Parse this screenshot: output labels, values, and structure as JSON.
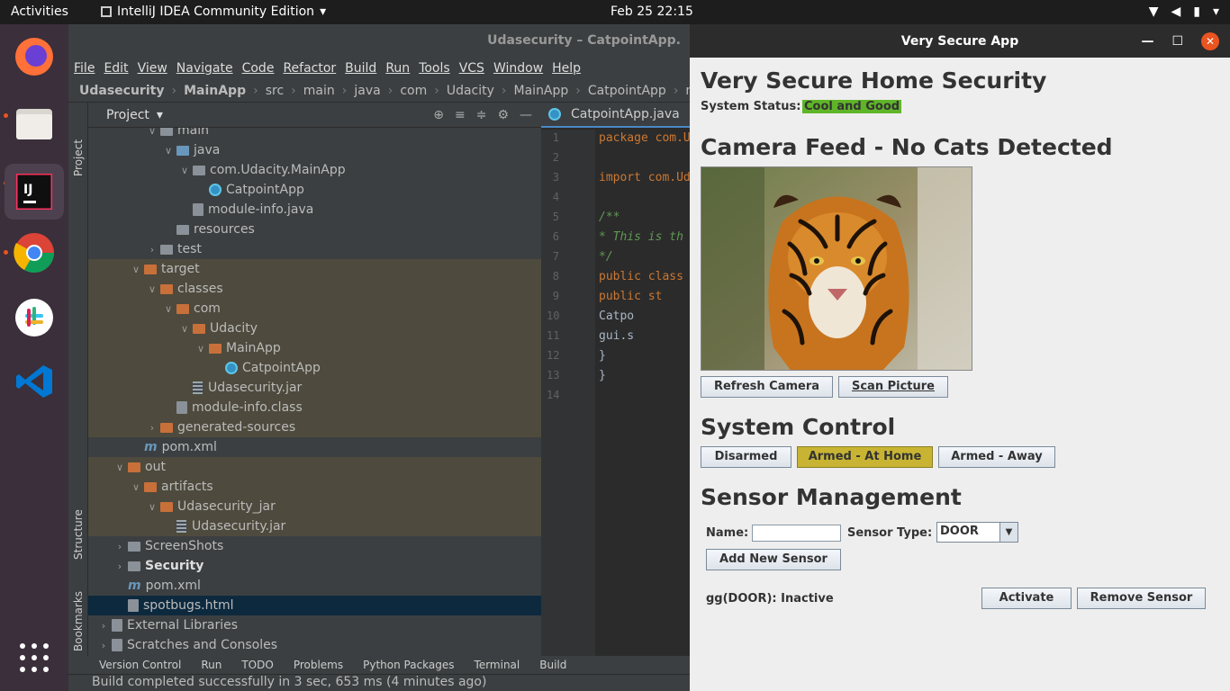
{
  "topbar": {
    "activities": "Activities",
    "app_menu": "IntelliJ IDEA Community Edition",
    "clock": "Feb 25  22:15"
  },
  "ide": {
    "window_title": "Udasecurity – CatpointApp.",
    "menu": [
      "File",
      "Edit",
      "View",
      "Navigate",
      "Code",
      "Refactor",
      "Build",
      "Run",
      "Tools",
      "VCS",
      "Window",
      "Help"
    ],
    "breadcrumbs": [
      "Udasecurity",
      "MainApp",
      "src",
      "main",
      "java",
      "com",
      "Udacity",
      "MainApp",
      "CatpointApp",
      "main"
    ],
    "side_tabs": {
      "project": "Project",
      "structure": "Structure",
      "bookmarks": "Bookmarks"
    },
    "project_label": "Project",
    "tree": [
      {
        "label": "main",
        "indent": 4,
        "icon": "folder-gray",
        "arrow": "down"
      },
      {
        "label": "java",
        "indent": 5,
        "icon": "folder-blue",
        "arrow": "down"
      },
      {
        "label": "com.Udacity.MainApp",
        "indent": 6,
        "icon": "package",
        "arrow": "down"
      },
      {
        "label": "CatpointApp",
        "indent": 7,
        "icon": "class"
      },
      {
        "label": "module-info.java",
        "indent": 6,
        "icon": "java"
      },
      {
        "label": "resources",
        "indent": 5,
        "icon": "folder-gray"
      },
      {
        "label": "test",
        "indent": 4,
        "icon": "folder-gray",
        "arrow": "right"
      },
      {
        "label": "target",
        "indent": 3,
        "icon": "folder-orange",
        "arrow": "down",
        "hl": true
      },
      {
        "label": "classes",
        "indent": 4,
        "icon": "folder-orange",
        "arrow": "down",
        "hl": true
      },
      {
        "label": "com",
        "indent": 5,
        "icon": "folder-orange",
        "arrow": "down",
        "hl": true
      },
      {
        "label": "Udacity",
        "indent": 6,
        "icon": "folder-orange",
        "arrow": "down",
        "hl": true
      },
      {
        "label": "MainApp",
        "indent": 7,
        "icon": "folder-orange",
        "arrow": "down",
        "hl": true
      },
      {
        "label": "CatpointApp",
        "indent": 8,
        "icon": "class",
        "hl": true
      },
      {
        "label": "Udasecurity.jar",
        "indent": 6,
        "icon": "jar",
        "hl": true
      },
      {
        "label": "module-info.class",
        "indent": 5,
        "icon": "classfile",
        "hl": true
      },
      {
        "label": "generated-sources",
        "indent": 4,
        "icon": "folder-orange",
        "arrow": "right",
        "hl": true
      },
      {
        "label": "pom.xml",
        "indent": 3,
        "icon": "maven"
      },
      {
        "label": "out",
        "indent": 2,
        "icon": "folder-orange",
        "arrow": "down",
        "hl": true
      },
      {
        "label": "artifacts",
        "indent": 3,
        "icon": "folder-orange",
        "arrow": "down",
        "hl": true
      },
      {
        "label": "Udasecurity_jar",
        "indent": 4,
        "icon": "folder-orange",
        "arrow": "down",
        "hl": true
      },
      {
        "label": "Udasecurity.jar",
        "indent": 5,
        "icon": "jar",
        "hl": true
      },
      {
        "label": "ScreenShots",
        "indent": 2,
        "icon": "folder-gray",
        "arrow": "right"
      },
      {
        "label": "Security",
        "indent": 2,
        "icon": "folder-gray",
        "arrow": "right",
        "bold": true
      },
      {
        "label": "pom.xml",
        "indent": 2,
        "icon": "maven"
      },
      {
        "label": "spotbugs.html",
        "indent": 2,
        "icon": "html",
        "sel": true
      },
      {
        "label": "External Libraries",
        "indent": 1,
        "icon": "libs",
        "arrow": "right"
      },
      {
        "label": "Scratches and Consoles",
        "indent": 1,
        "icon": "scratch",
        "arrow": "right"
      }
    ],
    "editor_tab": "CatpointApp.java",
    "code_lines": [
      {
        "n": "1",
        "text": "package com.U",
        "cls": "kw"
      },
      {
        "n": "2",
        "text": ""
      },
      {
        "n": "3",
        "text": "import com.Ud",
        "cls": "kw"
      },
      {
        "n": "4",
        "text": ""
      },
      {
        "n": "5",
        "text": "/**",
        "cls": "cm"
      },
      {
        "n": "6",
        "text": " * This is th",
        "cls": "cm"
      },
      {
        "n": "7",
        "text": " */",
        "cls": "cm"
      },
      {
        "n": "8",
        "text": "public class ",
        "cls": "kw"
      },
      {
        "n": "9",
        "text": "    public st",
        "cls": "kw"
      },
      {
        "n": "10",
        "text": "        Catpo"
      },
      {
        "n": "11",
        "text": "        gui.s"
      },
      {
        "n": "12",
        "text": "    }"
      },
      {
        "n": "13",
        "text": "}"
      },
      {
        "n": "14",
        "text": ""
      }
    ],
    "bottom_tabs": [
      "Version Control",
      "Run",
      "TODO",
      "Problems",
      "Python Packages",
      "Terminal",
      "Build"
    ],
    "status": "Build completed successfully in 3 sec, 653 ms (4 minutes ago)"
  },
  "app": {
    "window_title": "Very Secure App",
    "heading": "Very Secure Home Security",
    "system_status_label": "System Status:",
    "system_status_value": "Cool and Good",
    "status_color": "#5fb528",
    "camera_heading": "Camera Feed - No Cats Detected",
    "refresh_camera": "Refresh Camera",
    "scan_picture": "Scan Picture",
    "control_heading": "System Control",
    "disarmed": "Disarmed",
    "armed_home": "Armed - At Home",
    "armed_away": "Armed - Away",
    "armed_color": "#c8b432",
    "sensor_heading": "Sensor Management",
    "name_label": "Name:",
    "name_value": "",
    "sensor_type_label": "Sensor Type:",
    "sensor_type_value": "DOOR",
    "add_sensor": "Add New Sensor",
    "sensor_row": "gg(DOOR): Inactive",
    "activate": "Activate",
    "remove_sensor": "Remove Sensor"
  }
}
